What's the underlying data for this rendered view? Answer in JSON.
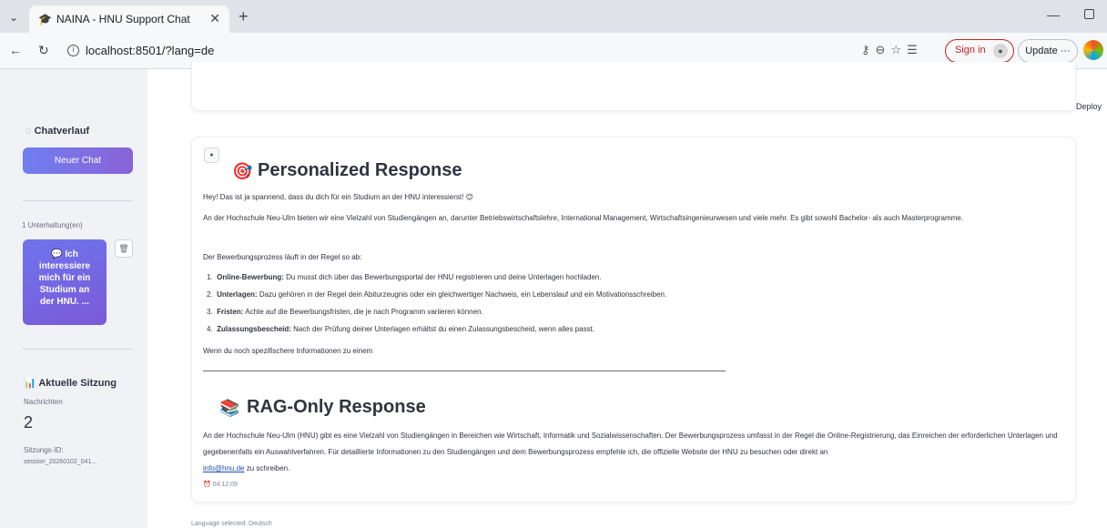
{
  "browser": {
    "tab_title": "NAINA - HNU Support Chat",
    "url": "localhost:8501/?lang=de",
    "signin_label": "Sign in",
    "update_label": "Update ···"
  },
  "icons": {
    "tab_favicon": "🎓",
    "session_chart": "📊",
    "target": "🎯",
    "books": "📚",
    "user_message": "💬",
    "smile": "😊",
    "clock": "⏰"
  },
  "sidebar": {
    "history_title": "Chatverlauf",
    "new_chat_label": "Neuer Chat",
    "conversation_count": "1 Unterhaltung(en)",
    "conversation_item": "Ich interessiere mich für ein Studium an der HNU. ...",
    "session_title": "Aktuelle Sitzung",
    "messages_label": "Nachrichten",
    "messages_value": "2",
    "session_id_label": "Sitzungs-ID:",
    "session_id_value": "session_20260102_041..."
  },
  "main": {
    "deploy_label": "Deploy",
    "personalized": {
      "heading": "Personalized Response",
      "intro": "Hey! Das ist ja spannend, dass du dich für ein Studium an der HNU interessierst!",
      "paragraph": "An der Hochschule Neu-Ulm bieten wir eine Vielzahl von Studiengängen an, darunter Betriebswirtschaftslehre, International Management, Wirtschaftsingenieurwesen und viele mehr. Es gibt sowohl Bachelor- als auch Masterprogramme.",
      "process_intro": "Der Bewerbungsprozess läuft in der Regel so ab:",
      "steps": [
        {
          "number": "1.",
          "title": "Online-Bewerbung:",
          "text": "Du musst dich über das Bewerbungsportal der HNU registrieren und deine Unterlagen hochladen."
        },
        {
          "number": "2.",
          "title": "Unterlagen:",
          "text": "Dazu gehören in der Regel dein Abiturzeugnis oder ein gleichwertiger Nachweis, ein Lebenslauf und ein Motivationsschreiben."
        },
        {
          "number": "3.",
          "title": "Fristen:",
          "text": "Achte auf die Bewerbungsfristen, die je nach Programm variieren können."
        },
        {
          "number": "4.",
          "title": "Zulassungsbescheid:",
          "text": "Nach der Prüfung deiner Unterlagen erhältst du einen Zulassungsbescheid, wenn alles passt."
        }
      ],
      "closing": "Wenn du noch spezifischere Informationen zu einem"
    },
    "rag": {
      "heading": "RAG-Only Response",
      "paragraph": "An der Hochschule Neu-Ulm (HNU) gibt es eine Vielzahl von Studiengängen in Bereichen wie Wirtschaft, Informatik und Sozialwissenschaften. Der Bewerbungsprozess umfasst in der Regel die Online-Registrierung, das Einreichen der erforderlichen Unterlagen und gegebenenfalls ein Auswahlverfahren. Für detaillierte Informationen zu den Studiengängen und dem Bewerbungsprozess empfehle ich, die offizielle Website der HNU zu besuchen oder direkt an",
      "email": "info@hnu.de",
      "paragraph_end": "zu schreiben."
    },
    "timestamp": "04:12:09",
    "footer": "Language selected: Deutsch"
  }
}
